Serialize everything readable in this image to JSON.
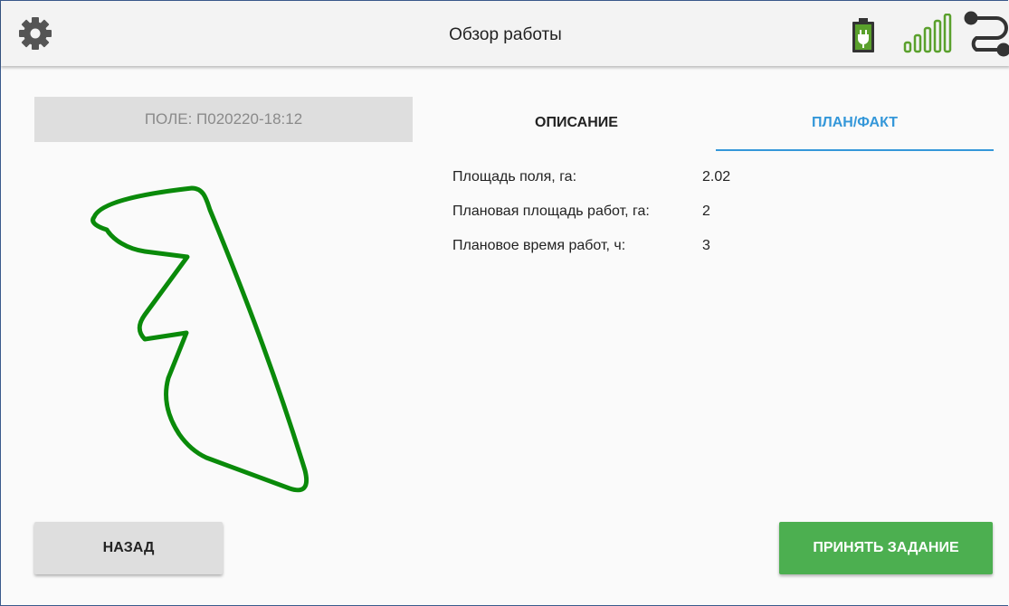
{
  "header": {
    "title": "Обзор работы",
    "icons": [
      "gear-icon",
      "battery-charging-icon",
      "signal-strength-icon",
      "route-icon"
    ],
    "battery_color": "#5aa02c"
  },
  "field": {
    "label": "ПОЛЕ: П020220-18:12",
    "outline_color": "#0a8a0a"
  },
  "tabs": [
    {
      "label": "ОПИСАНИЕ",
      "active": false
    },
    {
      "label": "ПЛАН/ФАКТ",
      "active": true
    }
  ],
  "info": [
    {
      "label": "Площадь поля, га:",
      "value": "2.02"
    },
    {
      "label": "Плановая площадь работ, га:",
      "value": "2"
    },
    {
      "label": "Плановое время работ, ч:",
      "value": "3"
    }
  ],
  "buttons": {
    "back": "НАЗАД",
    "accept": "ПРИНЯТЬ ЗАДАНИЕ"
  },
  "colors": {
    "accent": "#3497d9",
    "accept": "#4caf50"
  }
}
